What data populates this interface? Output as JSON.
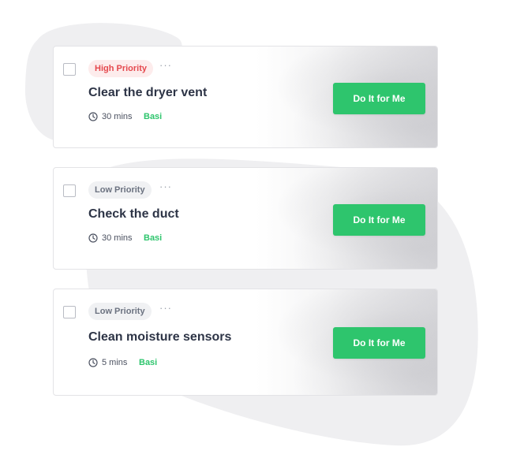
{
  "colors": {
    "accent_green": "#2ec56d",
    "high_priority": "#e5484d",
    "low_priority": "#6b7280",
    "title_text": "#2d3446",
    "blob": "#efeff1"
  },
  "icons": {
    "more": "ellipsis-icon",
    "time": "clock-icon"
  },
  "tasks": [
    {
      "priority": "High Priority",
      "more": "···",
      "title": "Clear the dryer vent",
      "duration": "30 mins",
      "category": "Basi",
      "action": "Do It for Me"
    },
    {
      "priority": "Low Priority",
      "more": "···",
      "title": "Check the duct",
      "duration": "30 mins",
      "category": "Basi",
      "action": "Do It for Me"
    },
    {
      "priority": "Low Priority",
      "more": "···",
      "title": "Clean moisture sensors",
      "duration": "5 mins",
      "category": "Basi",
      "action": "Do It for Me"
    }
  ]
}
